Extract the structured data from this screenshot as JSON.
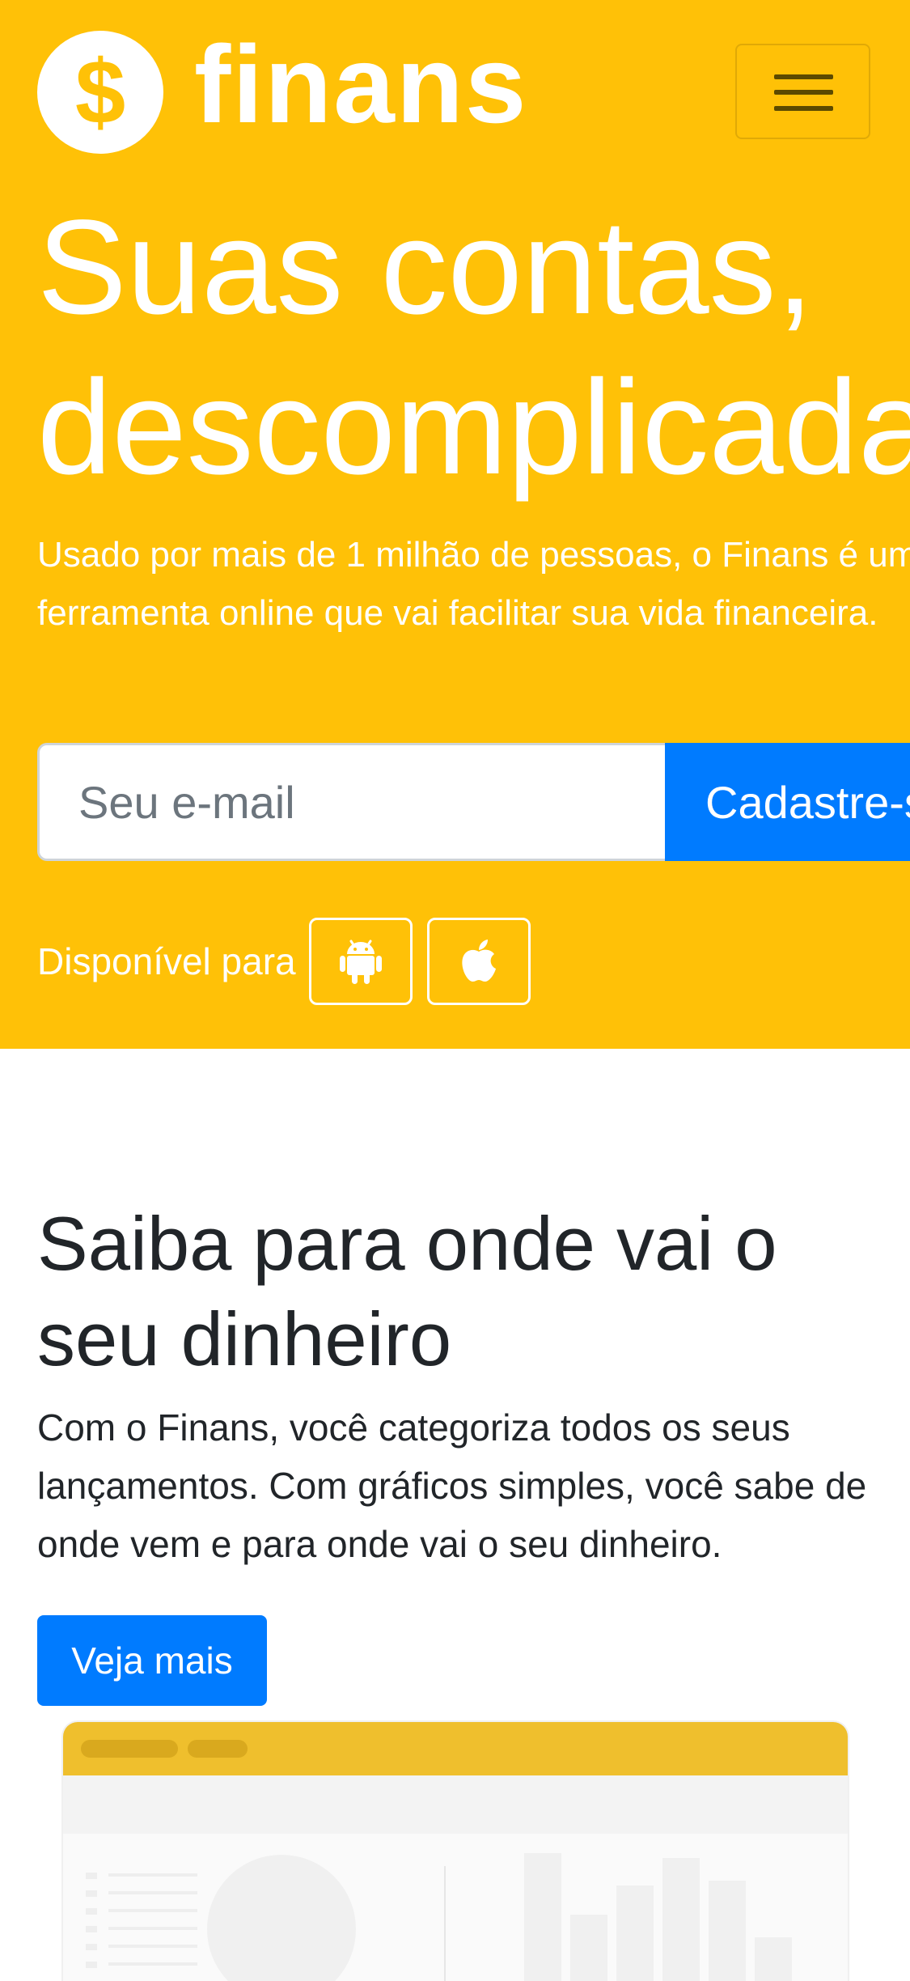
{
  "header": {
    "logo_symbol": "$",
    "logo_text": "finans",
    "menu_icon": "hamburger-menu-icon"
  },
  "hero": {
    "headline_line1": "Suas contas,",
    "headline_line2": "descomplicadas",
    "lead": "Usado por mais de 1 milhão de pessoas, o Finans é uma ferramenta online que vai facilitar sua vida financeira.",
    "email_placeholder": "Seu e-mail",
    "signup_label": "Cadastre-se",
    "available_label": "Disponível para",
    "platforms": [
      "android-icon",
      "apple-icon"
    ]
  },
  "section": {
    "title": "Saiba para onde vai o seu dinheiro",
    "text": "Com o Finans, você categoriza todos os seus lançamentos. Com gráficos simples, você sabe de onde vem e para onde vai o seu dinheiro.",
    "button_label": "Veja mais"
  },
  "colors": {
    "brand_yellow": "#FFC107",
    "primary_blue": "#007BFF",
    "text_dark": "#212529",
    "white": "#FFFFFF"
  }
}
